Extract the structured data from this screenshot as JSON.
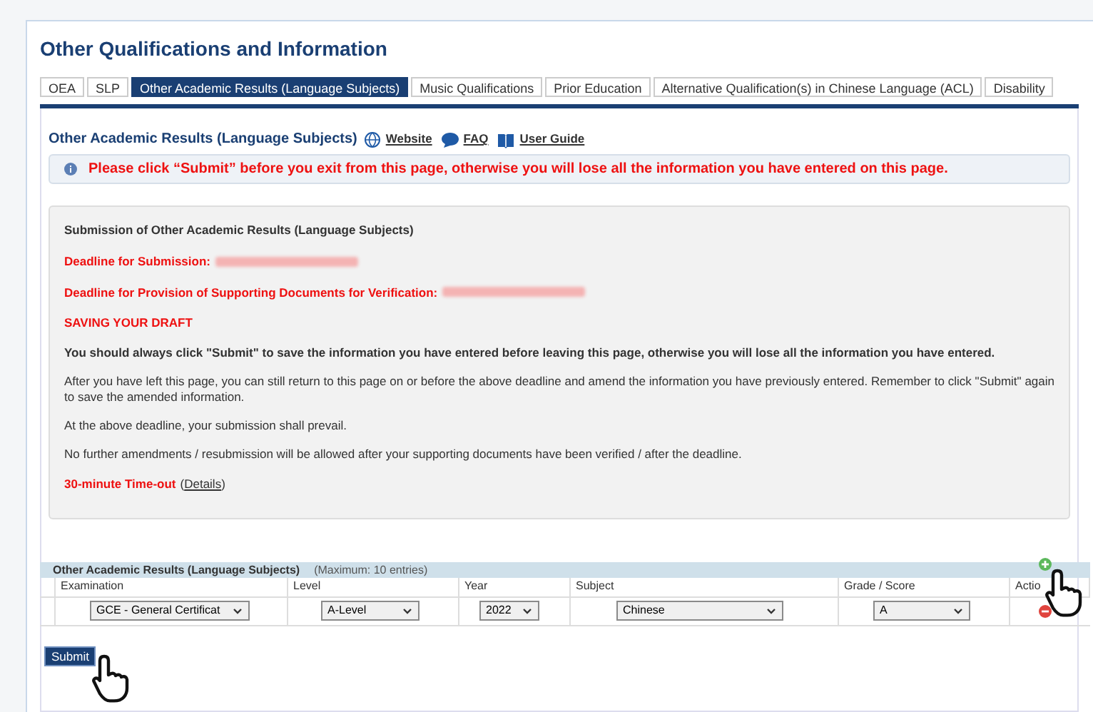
{
  "page_title": "Other Qualifications and Information",
  "tabs": [
    {
      "label": "OEA",
      "selected": false
    },
    {
      "label": "SLP",
      "selected": false
    },
    {
      "label": "Other Academic Results (Language Subjects)",
      "selected": true
    },
    {
      "label": "Music Qualifications",
      "selected": false
    },
    {
      "label": "Prior Education",
      "selected": false
    },
    {
      "label": "Alternative Qualification(s) in Chinese Language (ACL)",
      "selected": false
    },
    {
      "label": "Disability",
      "selected": false
    }
  ],
  "section": {
    "title": "Other Academic Results (Language Subjects)",
    "links": [
      {
        "kind": "globe",
        "label": "Website"
      },
      {
        "kind": "chat",
        "label": "FAQ"
      },
      {
        "kind": "book",
        "label": "User Guide"
      }
    ]
  },
  "alert": "Please click “Submit” before you exit from this page, otherwise you will lose all the information you have entered on this page.",
  "notice": {
    "heading": "Submission of Other Academic Results (Language Subjects)",
    "deadlines": [
      "Deadline for Submission:",
      "Deadline for Provision of Supporting Documents for Verification:"
    ],
    "draft_heading": "SAVING YOUR DRAFT",
    "warning": "You should always click \"Submit\" to save the information you have entered before leaving this page, otherwise you will lose all the information you have entered.",
    "paragraphs": [
      "After you have left this page, you can still return to this page on or before the above deadline and amend the information you have previously entered. Remember to click \"Submit\" again to save the amended information.",
      "At the above deadline, your submission shall prevail.",
      "No further amendments / resubmission will be allowed after your supporting documents have been verified / after the deadline."
    ],
    "timeout": "30-minute Time-out",
    "details_open": "(",
    "details_link": "Details",
    "details_close": ")"
  },
  "table": {
    "title": "Other Academic Results (Language Subjects)",
    "note": "(Maximum: 10 entries)",
    "columns": [
      "Examination",
      "Level",
      "Year",
      "Subject",
      "Grade / Score",
      "Actio"
    ],
    "rows": [
      {
        "examination": "GCE - General Certificat",
        "level": "A-Level",
        "year": "2022",
        "subject": "Chinese",
        "grade": "A"
      }
    ]
  },
  "submit": "Submit"
}
